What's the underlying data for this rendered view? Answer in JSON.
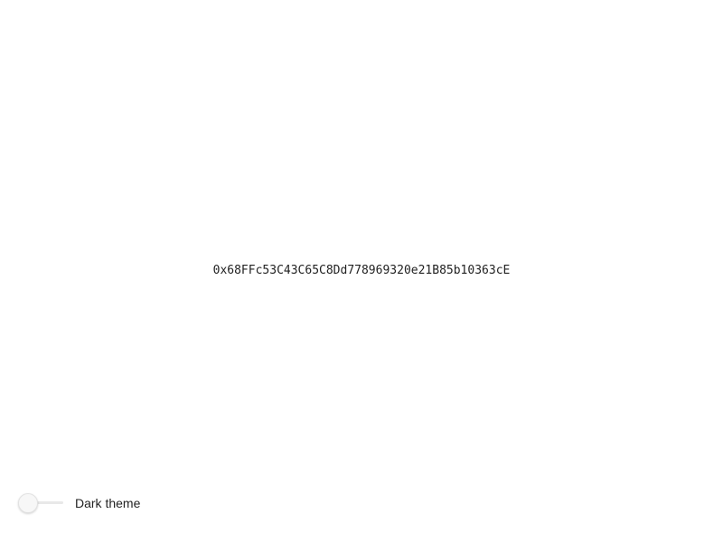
{
  "address": "0x68FFc53C43C65C8Dd778969320e21B85b10363cE",
  "theme_toggle": {
    "label": "Dark theme",
    "checked": false
  },
  "colors": {
    "background": "#ffffff",
    "text": "#222222",
    "track": "#e8e8e8",
    "knob": "#f7f7f7"
  }
}
